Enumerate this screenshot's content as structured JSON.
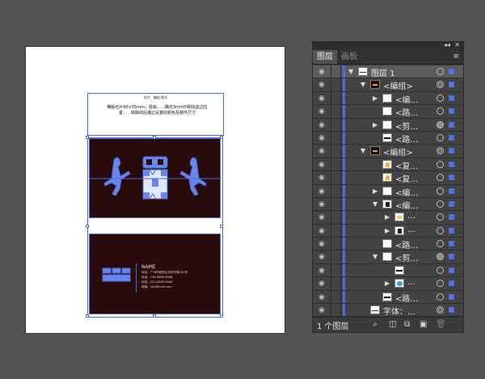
{
  "artboard": {
    "note_title": "名片：编组-版式",
    "note_text": "横版名片90×55mm，竖版，…确定3mm印刷出血边位置，…转曲线后描边设置好颜色及稿件尺寸"
  },
  "card_back": {
    "name_line": "NAME",
    "line1": "地址：广州市越秀区东风东路100号",
    "line2": "电话：138 8888 8888",
    "line3": "传真：020-8888 8888",
    "line4": "邮箱：info@mail.com"
  },
  "panel": {
    "collapse_icon_text": "◂◂",
    "close_icon_text": "✕",
    "tab_layers": "图层",
    "tab_artboards": "画板",
    "menu_icon_text": "≡",
    "rows": [
      {
        "label": "图层 1",
        "indent": 0,
        "tri": "down",
        "thumb": "text",
        "target": "plain",
        "selsq": "solid",
        "top": true
      },
      {
        "label": "<编组>",
        "indent": 1,
        "tri": "down",
        "thumb": "dark",
        "target": "double",
        "selsq": "solid"
      },
      {
        "label": "<编…",
        "indent": 2,
        "tri": "right",
        "thumb": "white",
        "target": "plain",
        "selsq": "solid"
      },
      {
        "label": "<路…",
        "indent": 2,
        "tri": "",
        "thumb": "white",
        "target": "plain",
        "selsq": "solid"
      },
      {
        "label": "<剪…",
        "indent": 2,
        "tri": "right",
        "thumb": "white",
        "target": "full",
        "selsq": "solid"
      },
      {
        "label": "<路…",
        "indent": 2,
        "tri": "",
        "thumb": "strip",
        "target": "plain",
        "selsq": "solid"
      },
      {
        "label": "<编组>",
        "indent": 1,
        "tri": "down",
        "thumb": "dark",
        "target": "double",
        "selsq": "solid"
      },
      {
        "label": "<复…",
        "indent": 2,
        "tri": "",
        "thumb": "gold",
        "target": "plain",
        "selsq": "solid"
      },
      {
        "label": "<复…",
        "indent": 2,
        "tri": "",
        "thumb": "gold",
        "target": "plain",
        "selsq": "solid"
      },
      {
        "label": "<编…",
        "indent": 2,
        "tri": "right",
        "thumb": "white",
        "target": "plain",
        "selsq": "solid"
      },
      {
        "label": "<编…",
        "indent": 2,
        "tri": "down",
        "thumb": "pattern",
        "target": "plain",
        "selsq": "solid"
      },
      {
        "label": "…",
        "indent": 3,
        "tri": "right",
        "thumb": "yellow",
        "target": "plain",
        "selsq": "solid"
      },
      {
        "label": "…",
        "indent": 3,
        "tri": "right",
        "thumb": "pattern",
        "target": "plain",
        "selsq": "solid"
      },
      {
        "label": "<路…",
        "indent": 2,
        "tri": "",
        "thumb": "white",
        "target": "plain",
        "selsq": "solid"
      },
      {
        "label": "<剪…",
        "indent": 2,
        "tri": "down",
        "thumb": "white",
        "target": "full",
        "selsq": "solid"
      },
      {
        "label": "",
        "indent": 3,
        "tri": "",
        "thumb": "strip",
        "target": "plain",
        "selsq": "solid"
      },
      {
        "label": "…",
        "indent": 3,
        "tri": "right",
        "thumb": "blue",
        "target": "plain",
        "selsq": "solid"
      },
      {
        "label": "<路…",
        "indent": 2,
        "tri": "",
        "thumb": "strip",
        "target": "plain",
        "selsq": "solid"
      },
      {
        "label": "字体：…",
        "indent": 1,
        "tri": "",
        "thumb": "text",
        "target": "double",
        "selsq": "solid"
      }
    ],
    "footer_count": "1 个图层",
    "footer_buttons": [
      "search-icon",
      "make-clipping-mask-icon",
      "create-sublayer-icon",
      "new-layer-icon",
      "delete-icon"
    ]
  },
  "colors": {
    "workspace": "#535353",
    "selection": "#4a6bdc",
    "card_bg": "#2a0b0b",
    "layer_color": "#4b6be0"
  }
}
